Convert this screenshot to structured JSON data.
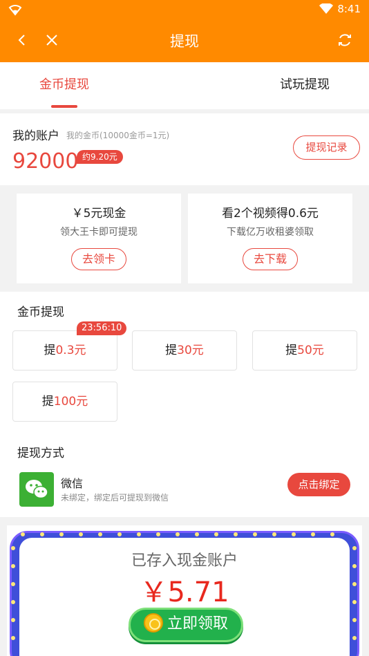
{
  "statusbar": {
    "time": "8:41"
  },
  "header": {
    "title": "提现"
  },
  "tabs": [
    {
      "label": "金币提现",
      "active": true
    },
    {
      "label": "试玩提现",
      "active": false
    }
  ],
  "account": {
    "title": "我的账户",
    "subtitle": "我的金币(10000金币=1元)",
    "coins": "92000",
    "approx": "约9.20元",
    "record_button": "提现记录"
  },
  "promos": [
    {
      "title": "￥5元现金",
      "desc": "领大王卡即可提现",
      "button": "去领卡"
    },
    {
      "title": "看2个视频得0.6元",
      "desc": "下载亿万收租婆领取",
      "button": "去下载"
    }
  ],
  "coin_withdraw": {
    "title": "金币提现",
    "timer": "23:56:10",
    "options": [
      {
        "prefix": "提",
        "amount": "0.3元"
      },
      {
        "prefix": "提",
        "amount": "30元"
      },
      {
        "prefix": "提",
        "amount": "50元"
      },
      {
        "prefix": "提",
        "amount": "100元"
      }
    ]
  },
  "method": {
    "title": "提现方式",
    "name": "微信",
    "desc": "未绑定，绑定后可提现到微信",
    "bind_button": "点击绑定"
  },
  "reward": {
    "label": "已存入现金账户",
    "amount": "￥5.71",
    "claim_button": "立即领取"
  },
  "colors": {
    "brand": "#ff8a00",
    "accent": "#e8483e",
    "wechat": "#3cb034",
    "claim": "#22b14c"
  }
}
